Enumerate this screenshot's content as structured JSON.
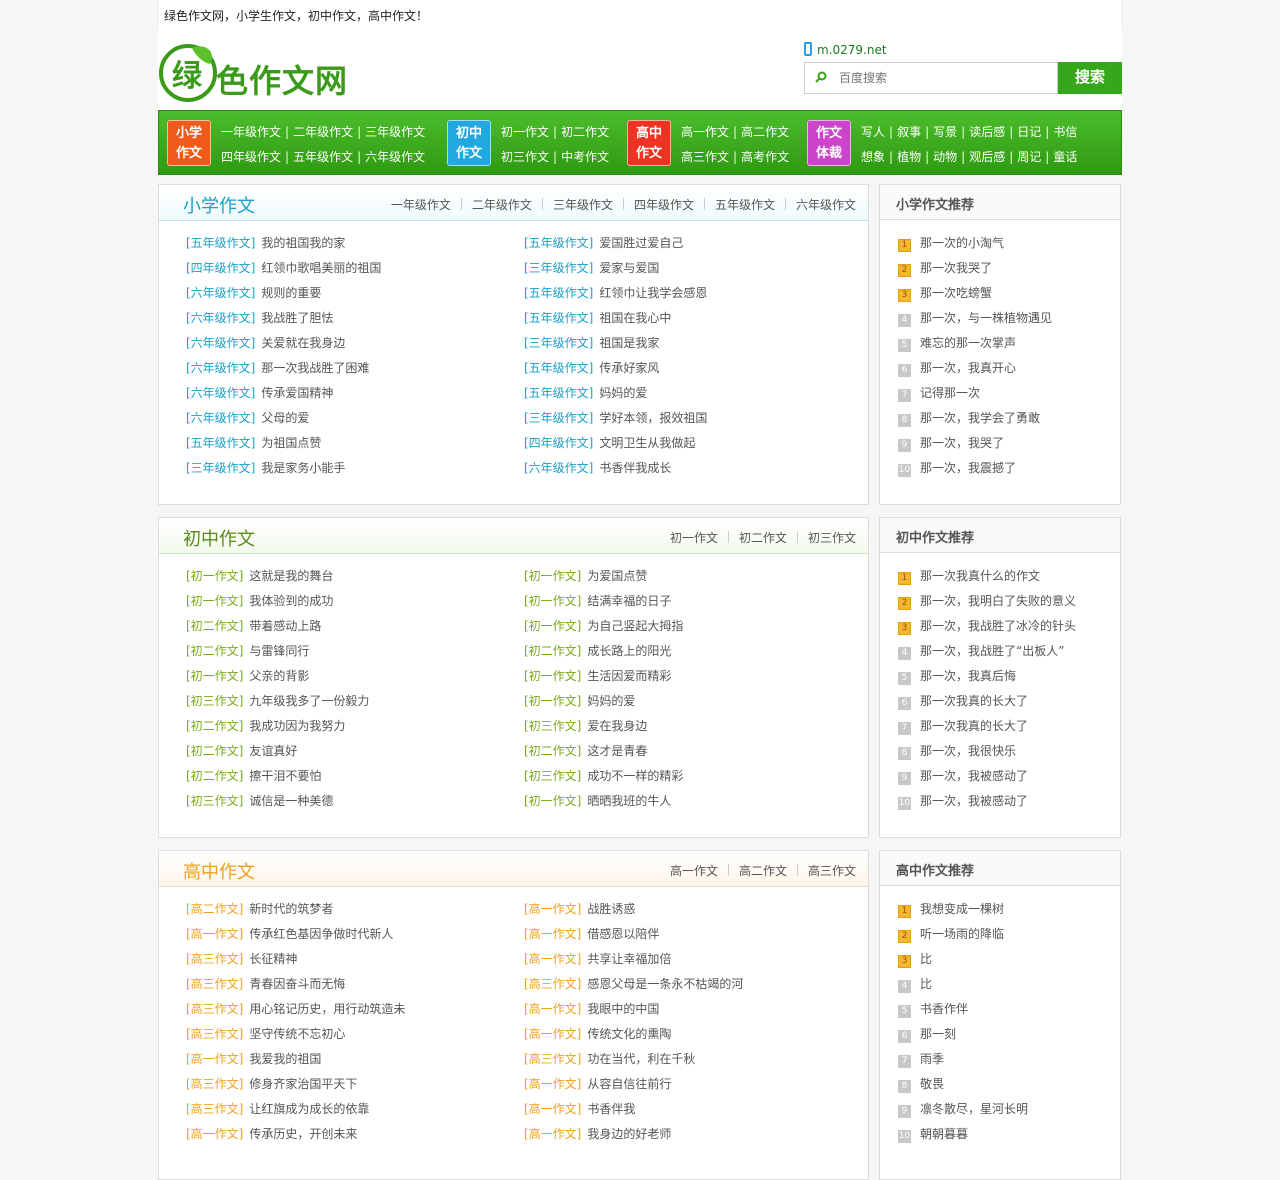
{
  "topbar": {
    "text": "绿色作文网，小学生作文，初中作文，高中作文！"
  },
  "header": {
    "logo_text": "色作文网",
    "logo_mark": "绿",
    "mobile": "m.0279.net",
    "search_placeholder": "百度搜索",
    "search_button": "搜索"
  },
  "colors": {
    "green": "#36a61b",
    "primary_cat": "#1aa0c8",
    "junior_cat": "#7aaa1a",
    "senior_cat": "#f0a020"
  },
  "nav": [
    {
      "tag": [
        "小学",
        "作文"
      ],
      "color": "#f05a1a",
      "row1": [
        "一年级作文",
        "二年级作文",
        "三年级作文"
      ],
      "row2": [
        "四年级作文",
        "五年级作文",
        "六年级作文"
      ]
    },
    {
      "tag": [
        "初中",
        "作文"
      ],
      "color": "#22a8e0",
      "row1": [
        "初一作文",
        "初二作文"
      ],
      "row2": [
        "初三作文",
        "中考作文"
      ]
    },
    {
      "tag": [
        "高中",
        "作文"
      ],
      "color": "#ee3322",
      "row1": [
        "高一作文",
        "高二作文"
      ],
      "row2": [
        "高三作文",
        "高考作文"
      ]
    },
    {
      "tag": [
        "作文",
        "体裁"
      ],
      "color": "#cc44cc",
      "row1": [
        "写人",
        "叙事",
        "写景",
        "读后感",
        "日记",
        "书信"
      ],
      "row2": [
        "想象",
        "植物",
        "动物",
        "观后感",
        "周记",
        "童话"
      ]
    }
  ],
  "primary": {
    "title": "小学作文",
    "subnav": [
      "一年级作文",
      "二年级作文",
      "三年级作文",
      "四年级作文",
      "五年级作文",
      "六年级作文"
    ],
    "left": [
      {
        "cat": "[五年级作文]",
        "title": "我的祖国我的家"
      },
      {
        "cat": "[四年级作文]",
        "title": "红领巾歌唱美丽的祖国"
      },
      {
        "cat": "[六年级作文]",
        "title": "规则的重要"
      },
      {
        "cat": "[六年级作文]",
        "title": "我战胜了胆怯"
      },
      {
        "cat": "[六年级作文]",
        "title": "关爱就在我身边"
      },
      {
        "cat": "[六年级作文]",
        "title": "那一次我战胜了困难"
      },
      {
        "cat": "[六年级作文]",
        "title": "传承爱国精神"
      },
      {
        "cat": "[六年级作文]",
        "title": "父母的爱"
      },
      {
        "cat": "[五年级作文]",
        "title": "为祖国点赞"
      },
      {
        "cat": "[三年级作文]",
        "title": "我是家务小能手"
      }
    ],
    "right": [
      {
        "cat": "[五年级作文]",
        "title": "爱国胜过爱自己"
      },
      {
        "cat": "[三年级作文]",
        "title": "爱家与爱国"
      },
      {
        "cat": "[五年级作文]",
        "title": "红领巾让我学会感恩"
      },
      {
        "cat": "[五年级作文]",
        "title": "祖国在我心中"
      },
      {
        "cat": "[三年级作文]",
        "title": "祖国是我家"
      },
      {
        "cat": "[五年级作文]",
        "title": "传承好家风"
      },
      {
        "cat": "[五年级作文]",
        "title": "妈妈的爱"
      },
      {
        "cat": "[三年级作文]",
        "title": "学好本领，报效祖国"
      },
      {
        "cat": "[四年级作文]",
        "title": "文明卫生从我做起"
      },
      {
        "cat": "[六年级作文]",
        "title": "书香伴我成长"
      }
    ],
    "side_title": "小学作文推荐",
    "side": [
      "那一次的小淘气",
      "那一次我哭了",
      "那一次吃螃蟹",
      "那一次，与一株植物遇见",
      "难忘的那一次掌声",
      "那一次，我真开心",
      "记得那一次",
      "那一次，我学会了勇敢",
      "那一次，我哭了",
      "那一次，我震撼了"
    ]
  },
  "junior": {
    "title": "初中作文",
    "subnav": [
      "初一作文",
      "初二作文",
      "初三作文"
    ],
    "left": [
      {
        "cat": "[初一作文]",
        "title": "这就是我的舞台"
      },
      {
        "cat": "[初一作文]",
        "title": "我体验到的成功"
      },
      {
        "cat": "[初二作文]",
        "title": "带着感动上路"
      },
      {
        "cat": "[初二作文]",
        "title": "与雷锋同行"
      },
      {
        "cat": "[初一作文]",
        "title": "父亲的背影"
      },
      {
        "cat": "[初三作文]",
        "title": "九年级我多了一份毅力"
      },
      {
        "cat": "[初二作文]",
        "title": "我成功因为我努力"
      },
      {
        "cat": "[初二作文]",
        "title": "友谊真好"
      },
      {
        "cat": "[初二作文]",
        "title": "擦干泪不要怕"
      },
      {
        "cat": "[初三作文]",
        "title": "诚信是一种美德"
      }
    ],
    "right": [
      {
        "cat": "[初一作文]",
        "title": "为爱国点赞"
      },
      {
        "cat": "[初一作文]",
        "title": "结满幸福的日子"
      },
      {
        "cat": "[初一作文]",
        "title": "为自己竖起大拇指"
      },
      {
        "cat": "[初二作文]",
        "title": "成长路上的阳光"
      },
      {
        "cat": "[初一作文]",
        "title": "生活因爱而精彩"
      },
      {
        "cat": "[初一作文]",
        "title": "妈妈的爱"
      },
      {
        "cat": "[初三作文]",
        "title": "爱在我身边"
      },
      {
        "cat": "[初二作文]",
        "title": "这才是青春"
      },
      {
        "cat": "[初三作文]",
        "title": "成功不一样的精彩"
      },
      {
        "cat": "[初一作文]",
        "title": "晒晒我班的牛人"
      }
    ],
    "side_title": "初中作文推荐",
    "side": [
      "那一次我真什么的作文",
      "那一次，我明白了失败的意义",
      "那一次，我战胜了冰冷的针头",
      "那一次，我战胜了“出板人”",
      "那一次，我真后悔",
      "那一次我真的长大了",
      "那一次我真的长大了",
      "那一次，我很快乐",
      "那一次，我被感动了",
      "那一次，我被感动了"
    ]
  },
  "senior": {
    "title": "高中作文",
    "subnav": [
      "高一作文",
      "高二作文",
      "高三作文"
    ],
    "left": [
      {
        "cat": "[高二作文]",
        "title": "新时代的筑梦者"
      },
      {
        "cat": "[高一作文]",
        "title": "传承红色基因争做时代新人"
      },
      {
        "cat": "[高三作文]",
        "title": "长征精神"
      },
      {
        "cat": "[高三作文]",
        "title": "青春因奋斗而无悔"
      },
      {
        "cat": "[高三作文]",
        "title": "用心铭记历史，用行动筑造未"
      },
      {
        "cat": "[高三作文]",
        "title": "坚守传统不忘初心"
      },
      {
        "cat": "[高一作文]",
        "title": "我爱我的祖国"
      },
      {
        "cat": "[高三作文]",
        "title": "修身齐家治国平天下"
      },
      {
        "cat": "[高三作文]",
        "title": "让红旗成为成长的依靠"
      },
      {
        "cat": "[高一作文]",
        "title": "传承历史，开创未来"
      }
    ],
    "right": [
      {
        "cat": "[高一作文]",
        "title": "战胜诱惑"
      },
      {
        "cat": "[高一作文]",
        "title": "借感恩以陪伴"
      },
      {
        "cat": "[高一作文]",
        "title": "共享让幸福加倍"
      },
      {
        "cat": "[高三作文]",
        "title": "感恩父母是一条永不枯竭的河"
      },
      {
        "cat": "[高一作文]",
        "title": "我眼中的中国"
      },
      {
        "cat": "[高一作文]",
        "title": "传统文化的熏陶"
      },
      {
        "cat": "[高三作文]",
        "title": "功在当代，利在千秋"
      },
      {
        "cat": "[高一作文]",
        "title": "从容自信往前行"
      },
      {
        "cat": "[高一作文]",
        "title": "书香伴我"
      },
      {
        "cat": "[高一作文]",
        "title": "我身边的好老师"
      }
    ],
    "side_title": "高中作文推荐",
    "side": [
      "我想变成一棵树",
      "听一场雨的降临",
      "比",
      "比",
      "书香作伴",
      "那一刻",
      "雨季",
      "敬畏",
      "凛冬散尽，星河长明",
      "朝朝暮暮"
    ]
  }
}
